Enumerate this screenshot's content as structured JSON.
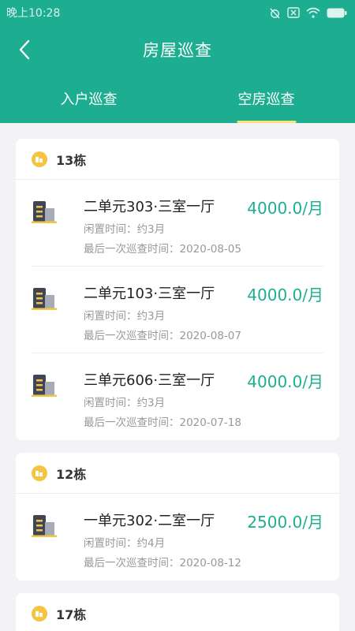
{
  "status": {
    "time": "晚上10:28"
  },
  "nav": {
    "title": "房屋巡查"
  },
  "tabs": [
    {
      "label": "入户巡查"
    },
    {
      "label": "空房巡查"
    }
  ],
  "buildings": [
    {
      "name": "13栋",
      "houses": [
        {
          "name": "二单元303·三室一厅",
          "idle": "闲置时间：约3月",
          "last": "最后一次巡查时间：2020-08-05",
          "price": "4000.0/月"
        },
        {
          "name": "二单元103·三室一厅",
          "idle": "闲置时间：约3月",
          "last": "最后一次巡查时间：2020-08-07",
          "price": "4000.0/月"
        },
        {
          "name": "三单元606·三室一厅",
          "idle": "闲置时间：约3月",
          "last": "最后一次巡查时间：2020-07-18",
          "price": "4000.0/月"
        }
      ]
    },
    {
      "name": "12栋",
      "houses": [
        {
          "name": "一单元302·二室一厅",
          "idle": "闲置时间：约4月",
          "last": "最后一次巡查时间：2020-08-12",
          "price": "2500.0/月"
        }
      ]
    },
    {
      "name": "17栋",
      "houses": []
    }
  ],
  "colors": {
    "accent": "#1dae92",
    "tab_indicator": "#ffe27a",
    "coin": "#f5c443"
  }
}
